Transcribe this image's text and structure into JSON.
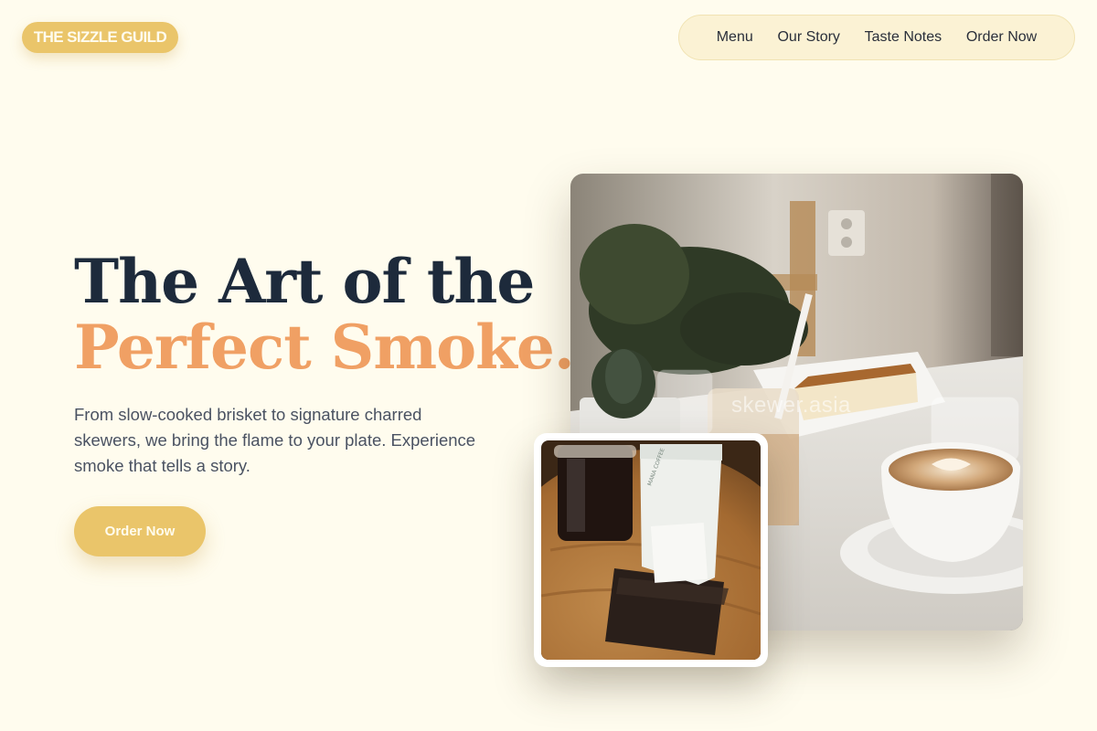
{
  "brand": {
    "logo_text": "THE SIZZLE GUILD"
  },
  "nav": {
    "items": [
      {
        "label": "Menu"
      },
      {
        "label": "Our Story"
      },
      {
        "label": "Taste Notes"
      },
      {
        "label": "Order Now"
      }
    ]
  },
  "hero": {
    "headline_line1": "The Art of the",
    "headline_line2": "Perfect Smoke.",
    "subtext": "From slow-cooked brisket to signature charred skewers, we bring the flame to your plate. Experience smoke that tells a story.",
    "cta_label": "Order Now"
  },
  "images": {
    "main_watermark": "skewer.asia"
  },
  "colors": {
    "background": "#fffcee",
    "accent_gold": "#eac56a",
    "headline_dark": "#1d2a3b",
    "headline_accent": "#f0a064",
    "body_text": "#4a5262"
  }
}
